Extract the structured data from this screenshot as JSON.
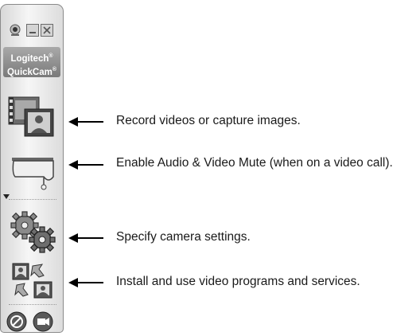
{
  "app": {
    "logo_line1": "Logitech",
    "logo_line2": "QuickCam",
    "logo_mark": "®"
  },
  "toolbar": {
    "camera_icon": "webcam-icon",
    "minimize_icon": "minimize-icon",
    "close_icon": "close-icon"
  },
  "sidebar_buttons": [
    {
      "icon": "film-capture-icon",
      "callout": "Record videos or capture images."
    },
    {
      "icon": "mute-screen-icon",
      "callout": "Enable Audio & Video Mute (when on a video call)."
    },
    {
      "icon": "settings-gears-icon",
      "callout": "Specify camera settings."
    },
    {
      "icon": "video-services-icon",
      "callout": "Install and use video programs and services."
    }
  ],
  "bottom_buttons": [
    {
      "icon": "help-icon"
    },
    {
      "icon": "video-camera-icon"
    }
  ],
  "colors": {
    "sidebar": "#e6e6e6",
    "logo_bg": "#8a8a8a",
    "arrow": "#000000"
  }
}
